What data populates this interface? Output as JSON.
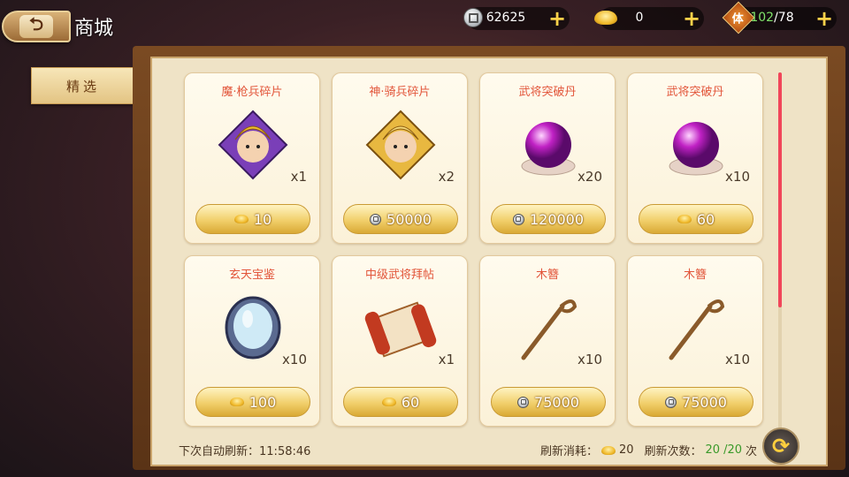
{
  "header": {
    "title": "商城",
    "back_icon": "back-arrow-icon",
    "currencies": [
      {
        "icon": "silver-coin-icon",
        "value": "62625"
      },
      {
        "icon": "gold-ingot-icon",
        "value": "0"
      },
      {
        "icon": "stamina-icon",
        "icon_text": "体",
        "value_current": "102",
        "value_max": "/78"
      }
    ],
    "plus_label": "+"
  },
  "sidebar": {
    "tabs": [
      {
        "label": "精选",
        "selected": true
      }
    ]
  },
  "shop": {
    "items": [
      {
        "name": "魔·枪兵碎片",
        "qty": "x1",
        "price": "10",
        "currency": "ingot",
        "art": "hero-shard-purple"
      },
      {
        "name": "神·骑兵碎片",
        "qty": "x2",
        "price": "50000",
        "currency": "coin",
        "art": "hero-shard-gold"
      },
      {
        "name": "武将突破丹",
        "qty": "x20",
        "price": "120000",
        "currency": "coin",
        "art": "breakthrough-orb"
      },
      {
        "name": "武将突破丹",
        "qty": "x10",
        "price": "60",
        "currency": "ingot",
        "art": "breakthrough-orb"
      },
      {
        "name": "玄天宝鉴",
        "qty": "x10",
        "price": "100",
        "currency": "ingot",
        "art": "mirror"
      },
      {
        "name": "中级武将拜帖",
        "qty": "x1",
        "price": "60",
        "currency": "ingot",
        "art": "scroll"
      },
      {
        "name": "木簪",
        "qty": "x10",
        "price": "75000",
        "currency": "coin",
        "art": "hairpin"
      },
      {
        "name": "木簪",
        "qty": "x10",
        "price": "75000",
        "currency": "coin",
        "art": "hairpin"
      }
    ],
    "auto_refresh_label": "下次自动刷新：",
    "auto_refresh_time": "11:58:46",
    "refresh_cost_label": "刷新消耗：",
    "refresh_cost": "20",
    "refresh_count_label": "刷新次数：",
    "refresh_count_current": "20",
    "refresh_count_max": "/20",
    "refresh_count_suffix": "次",
    "refresh_icon": "refresh-icon",
    "scroll_fraction": 0.62
  },
  "colors": {
    "item_name": "#e2553a",
    "count_green": "#3a9a2a"
  }
}
